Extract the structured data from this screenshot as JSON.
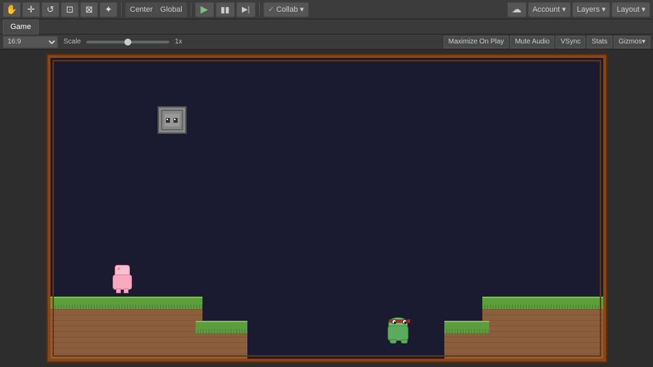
{
  "toolbar": {
    "tools": [
      {
        "name": "hand",
        "icon": "✋",
        "label": "Hand Tool"
      },
      {
        "name": "move",
        "icon": "✛",
        "label": "Move Tool"
      },
      {
        "name": "rotate",
        "icon": "↺",
        "label": "Rotate Tool"
      },
      {
        "name": "rect-transform",
        "icon": "⊡",
        "label": "Rect Transform"
      },
      {
        "name": "scale",
        "icon": "⊞",
        "label": "Scale Tool"
      },
      {
        "name": "custom-editor",
        "icon": "✏",
        "label": "Custom Editor Tool"
      }
    ],
    "pivot": {
      "center_label": "Center",
      "global_label": "Global"
    },
    "play": {
      "icon": "▶",
      "label": "Play"
    },
    "pause": {
      "icon": "⏸",
      "label": "Pause"
    },
    "step": {
      "icon": "⏭",
      "label": "Step"
    },
    "collab": {
      "label": "Collab",
      "icon": "▾"
    },
    "cloud": {
      "icon": "☁",
      "label": "Cloud"
    },
    "account": {
      "label": "Account",
      "icon": "▾"
    },
    "layers": {
      "label": "Layers",
      "icon": "▾"
    },
    "layout": {
      "label": "Layout",
      "icon": "▾"
    }
  },
  "game_tab": {
    "label": "Game"
  },
  "game_controls": {
    "aspect": "16:9",
    "scale_label": "Scale",
    "scale_value": "1x",
    "maximize_label": "Maximize On Play",
    "mute_label": "Mute Audio",
    "vsync_label": "VSync",
    "stats_label": "Stats",
    "gizmos_label": "Gizmos"
  },
  "scene": {
    "chest": {
      "label": "Chest/Box"
    },
    "player": {
      "label": "Player Character (Pig)"
    },
    "enemy": {
      "label": "Enemy (Frog)"
    },
    "platforms": [
      {
        "id": "left",
        "label": "Left Platform"
      },
      {
        "id": "left-float",
        "label": "Left Floating Platform"
      },
      {
        "id": "right",
        "label": "Right Platform"
      },
      {
        "id": "right-float",
        "label": "Right Floating Platform"
      }
    ]
  }
}
